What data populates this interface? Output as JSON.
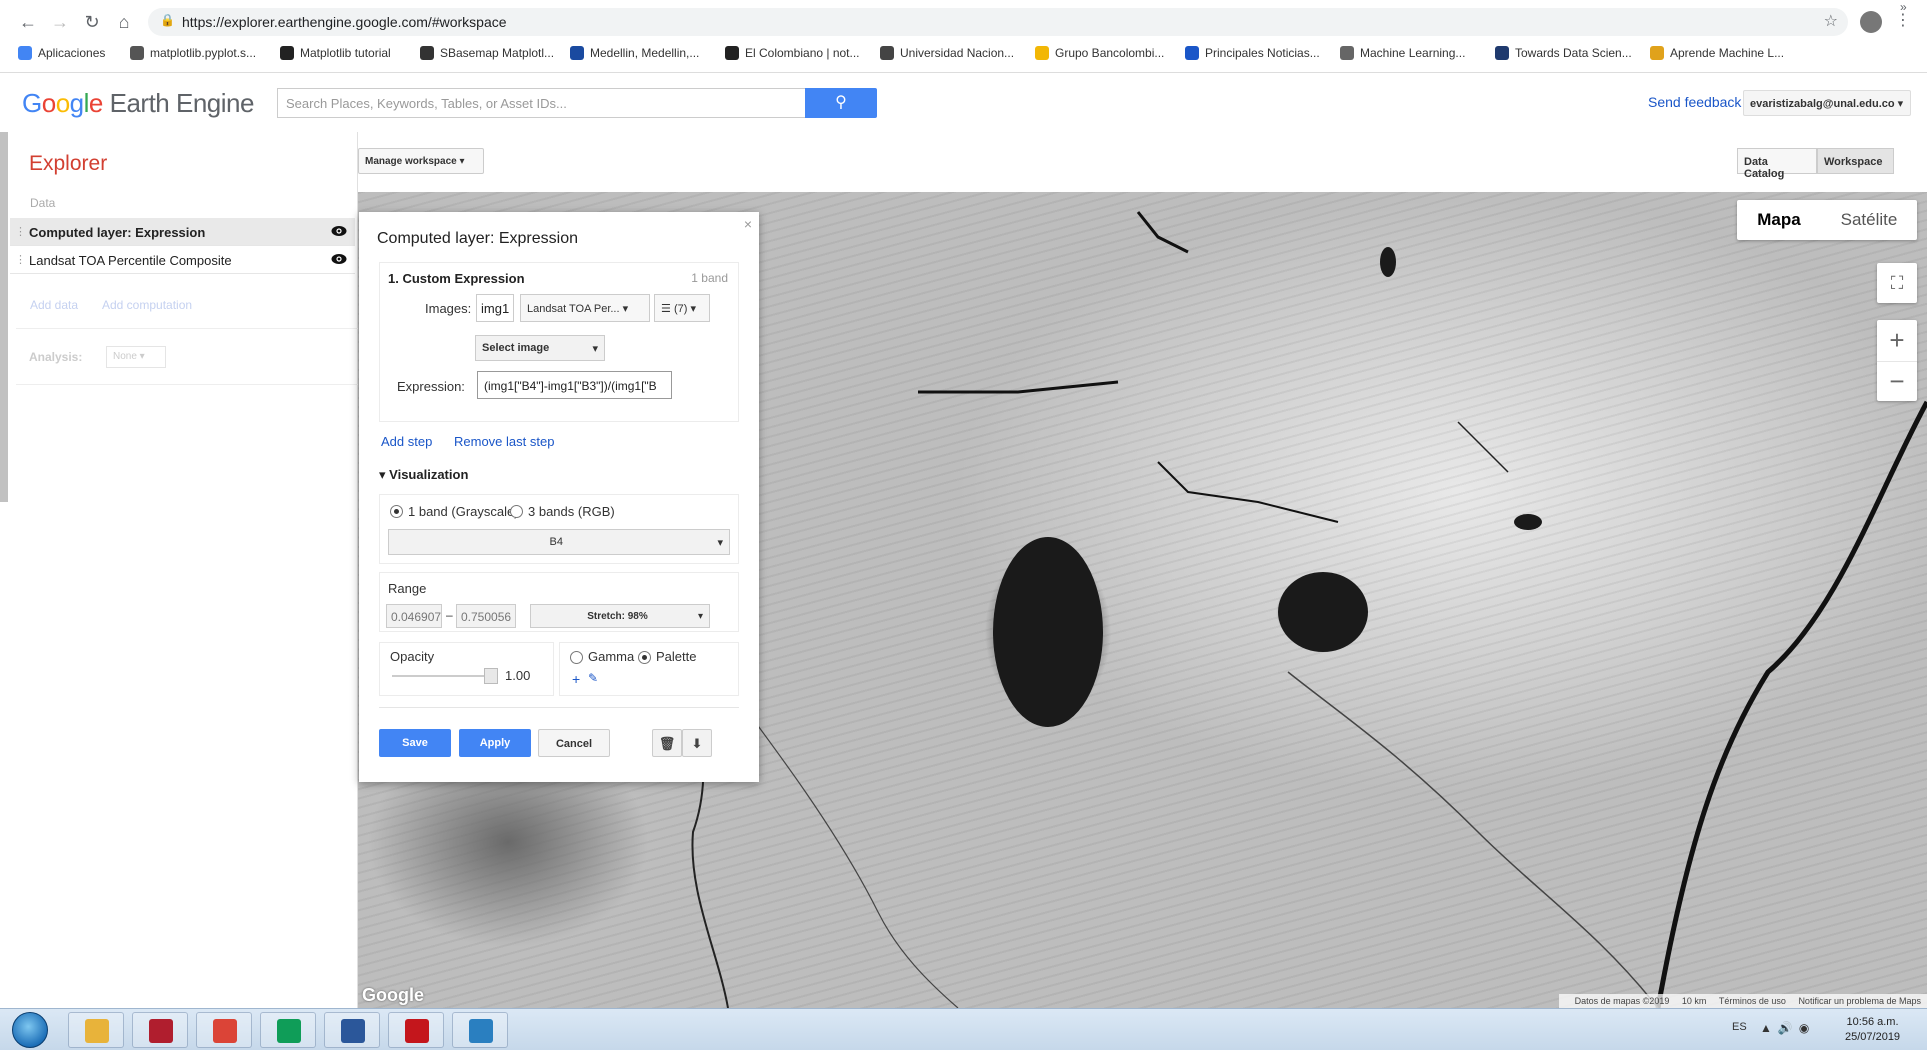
{
  "browser": {
    "url": "https://explorer.earthengine.google.com/#workspace",
    "bookmarks": [
      {
        "label": "Aplicaciones",
        "icon": "apps-grid-icon",
        "color": "#4285f4"
      },
      {
        "label": "matplotlib.pyplot.s...",
        "icon": "matplotlib-icon",
        "color": "#555555"
      },
      {
        "label": "Matplotlib tutorial",
        "icon": "github-icon",
        "color": "#222222"
      },
      {
        "label": "SBasemap Matplotl...",
        "icon": "globe-icon",
        "color": "#333333"
      },
      {
        "label": "Medellin, Medellin,...",
        "icon": "tv-icon",
        "color": "#1a4aa0"
      },
      {
        "label": "El Colombiano | not...",
        "icon": "elcolombiano-icon",
        "color": "#222222"
      },
      {
        "label": "Universidad Nacion...",
        "icon": "un-icon",
        "color": "#444444"
      },
      {
        "label": "Grupo Bancolombi...",
        "icon": "bancolombia-icon",
        "color": "#f2b705"
      },
      {
        "label": "Principales Noticias...",
        "icon": "et-icon",
        "color": "#1a56c8"
      },
      {
        "label": "Machine Learning...",
        "icon": "ml-icon",
        "color": "#666666"
      },
      {
        "label": "Towards Data Scien...",
        "icon": "tds-icon",
        "color": "#1f3a6e"
      },
      {
        "label": "Aprende Machine L...",
        "icon": "aprende-icon",
        "color": "#e0a21b"
      }
    ]
  },
  "header": {
    "logo_google": [
      "G",
      "o",
      "o",
      "g",
      "l",
      "e"
    ],
    "logo_rest": " Earth Engine",
    "search_placeholder": "Search Places, Keywords, Tables, or Asset IDs...",
    "send_feedback": "Send feedback",
    "account": "evaristizabalg@unal.edu.co"
  },
  "left_panel": {
    "title": "Explorer",
    "data_label": "Data",
    "layers": [
      {
        "name": "Computed layer: Expression",
        "visible": true
      },
      {
        "name": "Landsat TOA Percentile Composite",
        "visible": true
      }
    ],
    "add_data": "Add data",
    "add_computation": "Add computation",
    "analysis_label": "Analysis:",
    "analysis_value": "None"
  },
  "toolbar": {
    "manage_workspace": "Manage workspace",
    "tabs": [
      "Data Catalog",
      "Workspace"
    ],
    "active_tab": "Workspace"
  },
  "map": {
    "map_types": [
      "Mapa",
      "Satélite"
    ],
    "active_map_type": "Mapa",
    "footer": [
      "Datos de mapas ©2019",
      "10 km",
      "Términos de uso",
      "Notificar un problema de Maps"
    ],
    "watermark": "Google"
  },
  "dialog": {
    "title": "Computed layer: Expression",
    "step_title": "1. Custom Expression",
    "step_meta": "1 band",
    "images_label": "Images:",
    "image_var": "img1",
    "image_source": "Landsat TOA Per...",
    "bands_count": "(7)",
    "select_image": "Select image",
    "expression_label": "Expression:",
    "expression": "(img1[\"B4\"]-img1[\"B3\"])/(img1[\"B",
    "add_step": "Add step",
    "remove_last_step": "Remove last step",
    "visualization": "Visualization",
    "band_mode_grayscale": "1 band (Grayscale)",
    "band_mode_rgb": "3 bands (RGB)",
    "band_mode_selected": "1 band (Grayscale)",
    "band": "B4",
    "range_label": "Range",
    "range_min": "0.046907",
    "range_max": "0.750056",
    "stretch": "Stretch: 98%",
    "opacity_label": "Opacity",
    "opacity_value": "1.00",
    "gamma_label": "Gamma",
    "palette_label": "Palette",
    "color_mode_selected": "Palette",
    "save": "Save",
    "apply": "Apply",
    "cancel": "Cancel"
  },
  "taskbar": {
    "lang": "ES",
    "time": "10:56 a.m.",
    "date": "25/07/2019",
    "apps": [
      {
        "name": "explorer-app",
        "color": "#e8b33a"
      },
      {
        "name": "mendeley-app",
        "color": "#b01e2e"
      },
      {
        "name": "chrome-app",
        "color": "#db4437"
      },
      {
        "name": "chrome-app-2",
        "color": "#0f9d58"
      },
      {
        "name": "word-app",
        "color": "#2b579a"
      },
      {
        "name": "acrobat-app",
        "color": "#c4161c"
      },
      {
        "name": "search-app",
        "color": "#2a7fc0"
      }
    ]
  }
}
